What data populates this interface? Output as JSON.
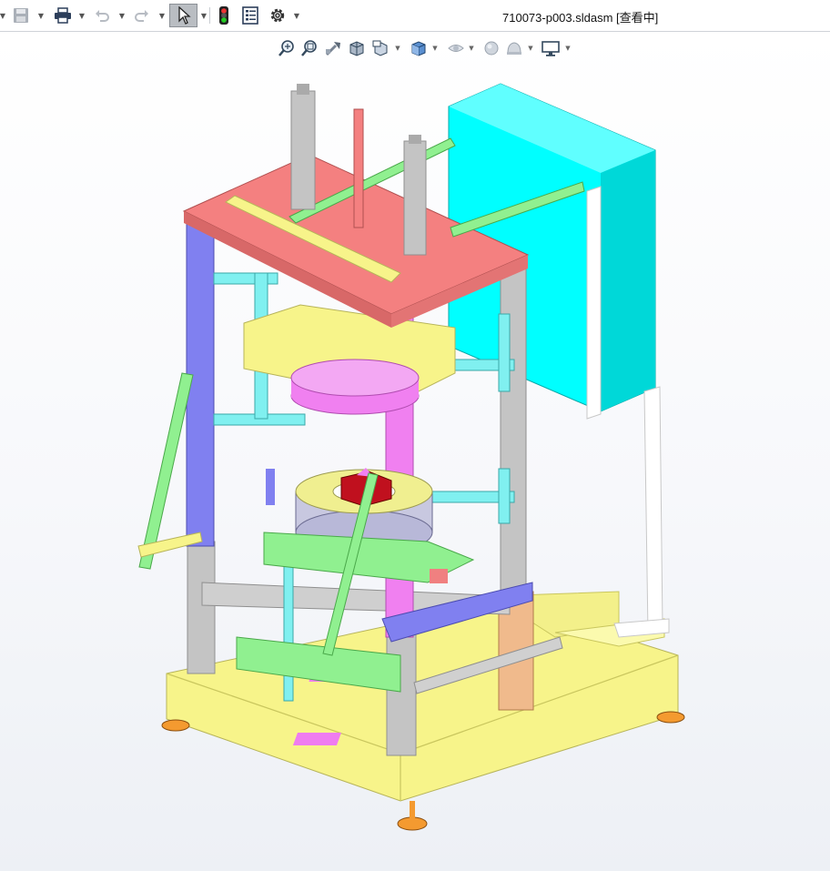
{
  "window": {
    "title": "710073-p003.sldasm [查看中]"
  },
  "toolbar": {
    "items": [
      {
        "name": "save-icon",
        "enabled": false
      },
      {
        "name": "print-icon",
        "enabled": true
      },
      {
        "name": "undo-icon",
        "enabled": false
      },
      {
        "name": "redo-icon",
        "enabled": false
      },
      {
        "name": "select-pointer-icon",
        "enabled": true,
        "active": true
      },
      {
        "name": "traffic-light-icon",
        "enabled": true
      },
      {
        "name": "file-properties-icon",
        "enabled": true
      },
      {
        "name": "gear-icon",
        "enabled": true
      }
    ]
  },
  "heads_up_view_toolbar": {
    "items": [
      {
        "name": "zoom-to-fit-icon"
      },
      {
        "name": "zoom-to-area-icon"
      },
      {
        "name": "previous-view-icon"
      },
      {
        "name": "section-view-icon"
      },
      {
        "name": "dynamic-annotation-icon"
      },
      {
        "name": "view-orientation-icon"
      },
      {
        "name": "display-style-icon"
      },
      {
        "name": "hide-show-items-icon"
      },
      {
        "name": "edit-appearance-icon"
      },
      {
        "name": "apply-scene-icon"
      },
      {
        "name": "view-settings-icon"
      }
    ]
  },
  "colors": {
    "frame_top": "#f48080",
    "frame_yellow": "#f7f48a",
    "frame_blue": "#8080f0",
    "frame_pink": "#f080f0",
    "frame_gray": "#c4c4c4",
    "frame_cyan": "#00ffff",
    "frame_green": "#90f090",
    "foot_orange": "#f49a30"
  }
}
